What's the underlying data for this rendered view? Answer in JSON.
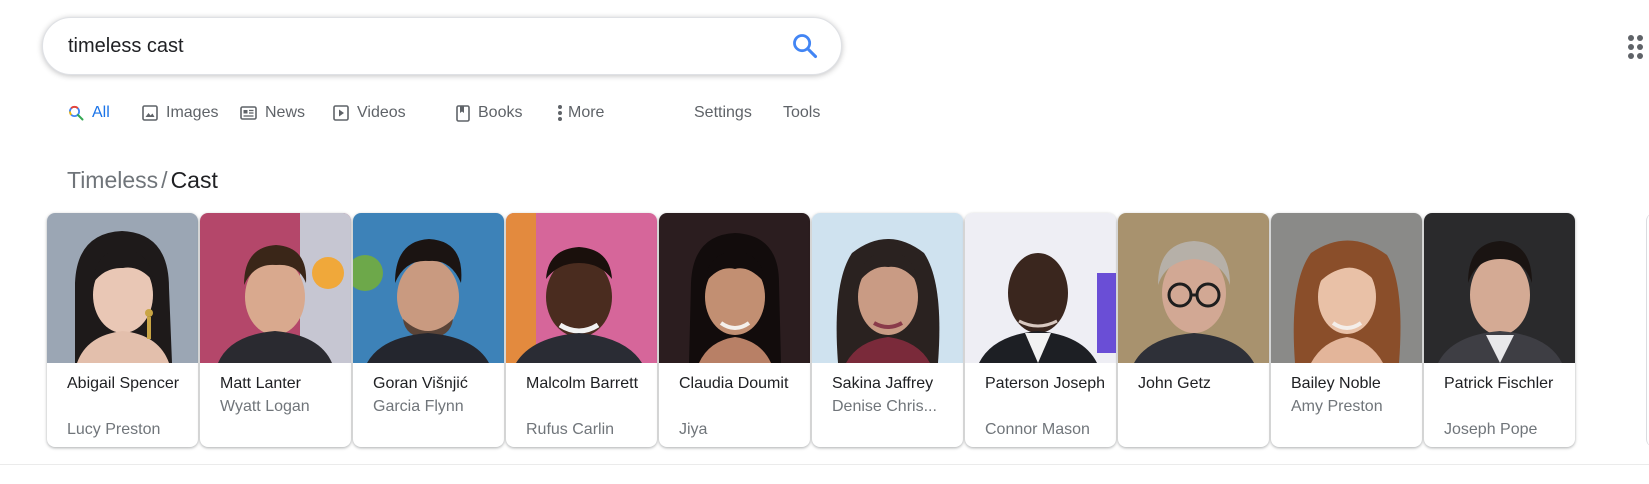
{
  "search": {
    "query": "timeless cast"
  },
  "tabs": [
    {
      "label": "All",
      "icon": "search-icon",
      "active": true
    },
    {
      "label": "Images",
      "icon": "image-icon"
    },
    {
      "label": "News",
      "icon": "news-icon"
    },
    {
      "label": "Videos",
      "icon": "video-icon"
    },
    {
      "label": "Books",
      "icon": "book-icon"
    },
    {
      "label": "More",
      "icon": "more-vertical-icon"
    },
    {
      "label": "Settings"
    },
    {
      "label": "Tools"
    }
  ],
  "breadcrumb": {
    "parent": "Timeless",
    "separator": "/",
    "current": "Cast"
  },
  "cast": [
    {
      "name": "Abigail Spencer",
      "role": "Lucy Preston"
    },
    {
      "name": "Matt Lanter",
      "role": "Wyatt Logan"
    },
    {
      "name": "Goran Višnjić",
      "role": "Garcia Flynn"
    },
    {
      "name": "Malcolm Barrett",
      "role": "Rufus Carlin"
    },
    {
      "name": "Claudia Doumit",
      "role": "Jiya"
    },
    {
      "name": "Sakina Jaffrey",
      "role": "Denise Chris..."
    },
    {
      "name": "Paterson Joseph",
      "role": "Connor Mason"
    },
    {
      "name": "John Getz",
      "role": ""
    },
    {
      "name": "Bailey Noble",
      "role": "Amy Preston"
    },
    {
      "name": "Patrick Fischler",
      "role": "Joseph Pope"
    }
  ],
  "colors": {
    "accent": "#1a73e8",
    "text": "#202124",
    "muted": "#70757a"
  }
}
